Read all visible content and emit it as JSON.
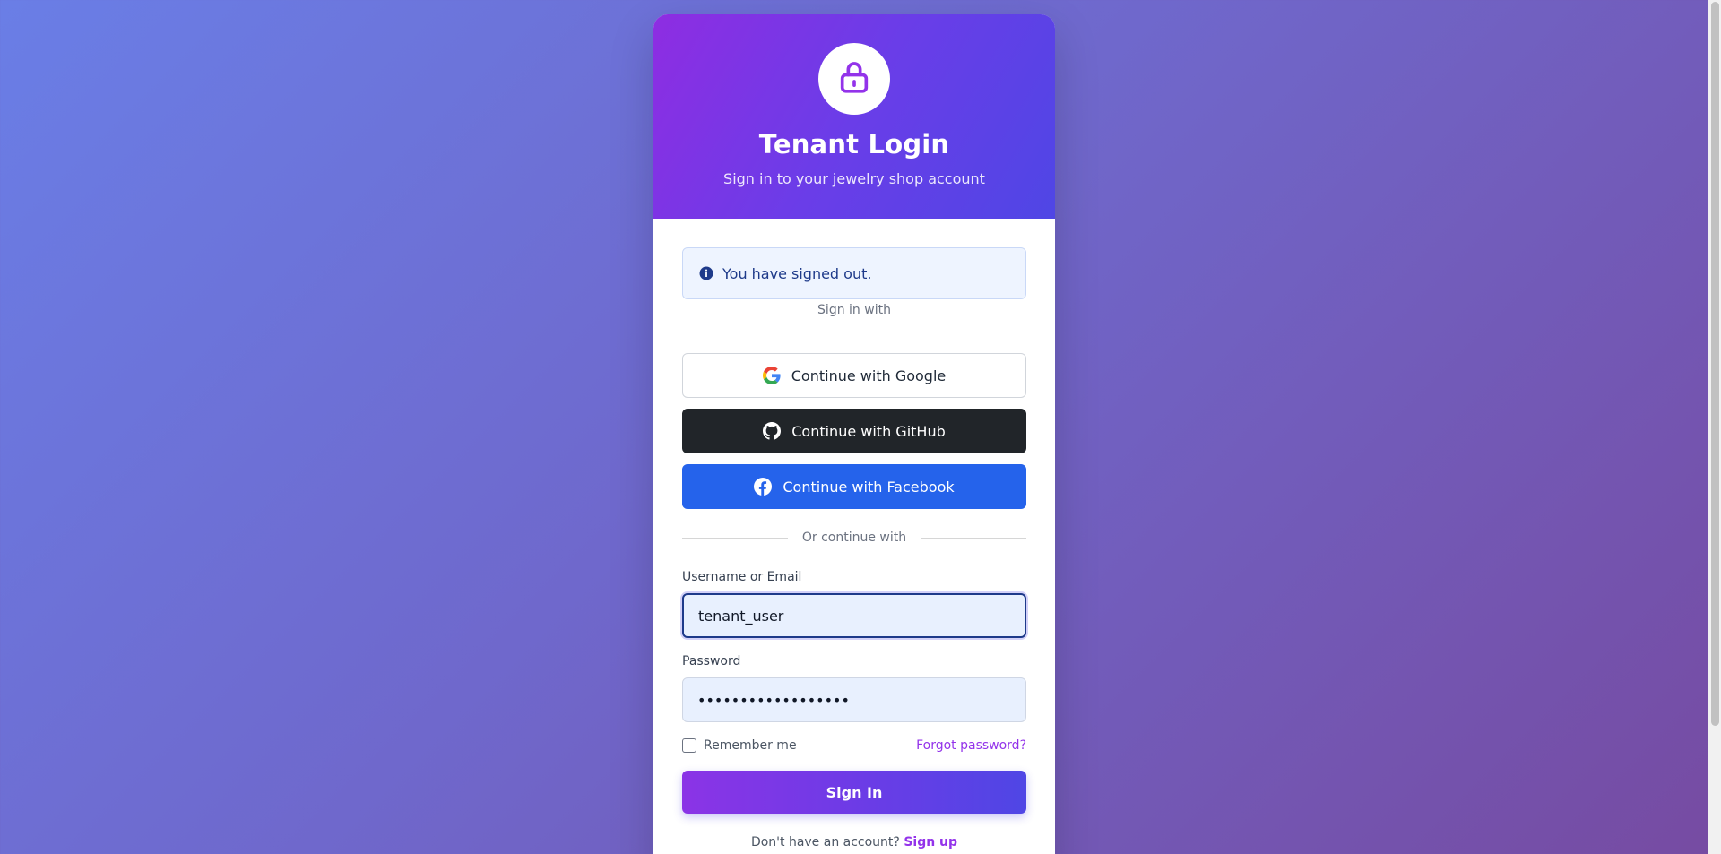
{
  "header": {
    "lock_icon": "lock-icon",
    "title": "Tenant Login",
    "subtitle": "Sign in to your jewelry shop account"
  },
  "alert": {
    "icon": "info-icon",
    "message": "You have signed out."
  },
  "social": {
    "heading": "Sign in with",
    "google_label": "Continue with Google",
    "github_label": "Continue with GitHub",
    "facebook_label": "Continue with Facebook"
  },
  "divider": {
    "text": "Or continue with"
  },
  "form": {
    "username_label": "Username or Email",
    "username_value": "tenant_user",
    "password_label": "Password",
    "password_value": "••••••••••••••••••",
    "remember_label": "Remember me",
    "remember_checked": false,
    "forgot_label": "Forgot password?",
    "submit_label": "Sign In"
  },
  "signup": {
    "prompt": "Don't have an account?",
    "link_label": "Sign up"
  },
  "colors": {
    "accent": "#9333ea",
    "header_gradient_start": "#8e2de2",
    "header_gradient_end": "#4f46e5",
    "github_bg": "#212529",
    "facebook_bg": "#2563eb"
  }
}
